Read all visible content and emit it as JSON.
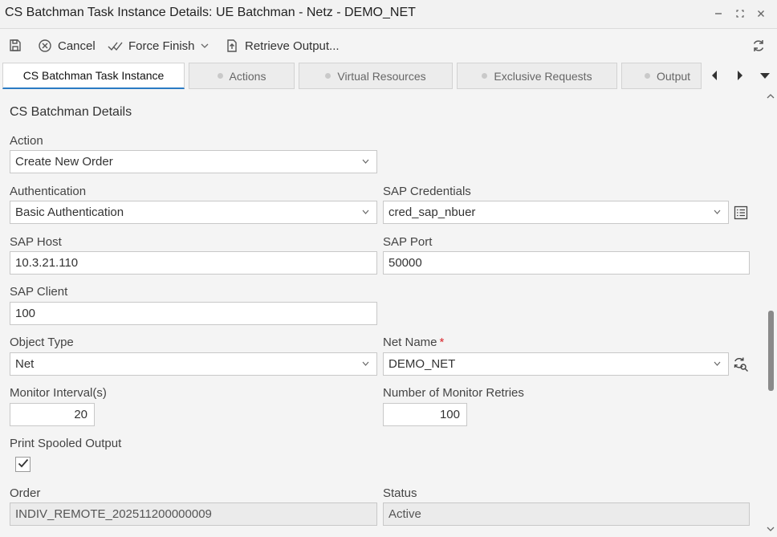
{
  "window": {
    "title": "CS Batchman Task Instance Details: UE Batchman - Netz - DEMO_NET"
  },
  "toolbar": {
    "cancel_label": "Cancel",
    "force_finish_label": "Force Finish",
    "retrieve_output_label": "Retrieve Output..."
  },
  "tabs": [
    {
      "label": "CS Batchman Task Instance",
      "active": true
    },
    {
      "label": "Actions",
      "active": false
    },
    {
      "label": "Virtual Resources",
      "active": false
    },
    {
      "label": "Exclusive Requests",
      "active": false
    },
    {
      "label": "Output",
      "active": false
    }
  ],
  "section": {
    "title": "CS Batchman Details"
  },
  "form": {
    "action": {
      "label": "Action",
      "value": "Create New Order"
    },
    "authentication": {
      "label": "Authentication",
      "value": "Basic Authentication"
    },
    "sap_credentials": {
      "label": "SAP Credentials",
      "value": "cred_sap_nbuer"
    },
    "sap_host": {
      "label": "SAP Host",
      "value": "10.3.21.110"
    },
    "sap_port": {
      "label": "SAP Port",
      "value": "50000"
    },
    "sap_client": {
      "label": "SAP Client",
      "value": "100"
    },
    "object_type": {
      "label": "Object Type",
      "value": "Net"
    },
    "net_name": {
      "label": "Net Name",
      "required_mark": "*",
      "value": "DEMO_NET"
    },
    "monitor_interval": {
      "label": "Monitor Interval(s)",
      "value": "20"
    },
    "monitor_retries": {
      "label": "Number of Monitor Retries",
      "value": "100"
    },
    "print_spooled_output": {
      "label": "Print Spooled Output",
      "checked": true
    },
    "order": {
      "label": "Order",
      "value": "INDIV_REMOTE_202511200000009"
    },
    "status": {
      "label": "Status",
      "value": "Active"
    }
  },
  "icons": {
    "save": "save-icon",
    "cancel": "cancel-icon",
    "force_finish": "force-finish-icon",
    "retrieve_output": "retrieve-output-icon",
    "refresh": "refresh-icon",
    "minimize": "minimize-icon",
    "maximize": "maximize-icon",
    "close": "close-icon",
    "list_details": "list-details-icon",
    "search_refresh": "search-refresh-icon"
  },
  "colors": {
    "accent": "#2b7bc4",
    "required": "#d9262c",
    "readonly_bg": "#ebebeb"
  }
}
